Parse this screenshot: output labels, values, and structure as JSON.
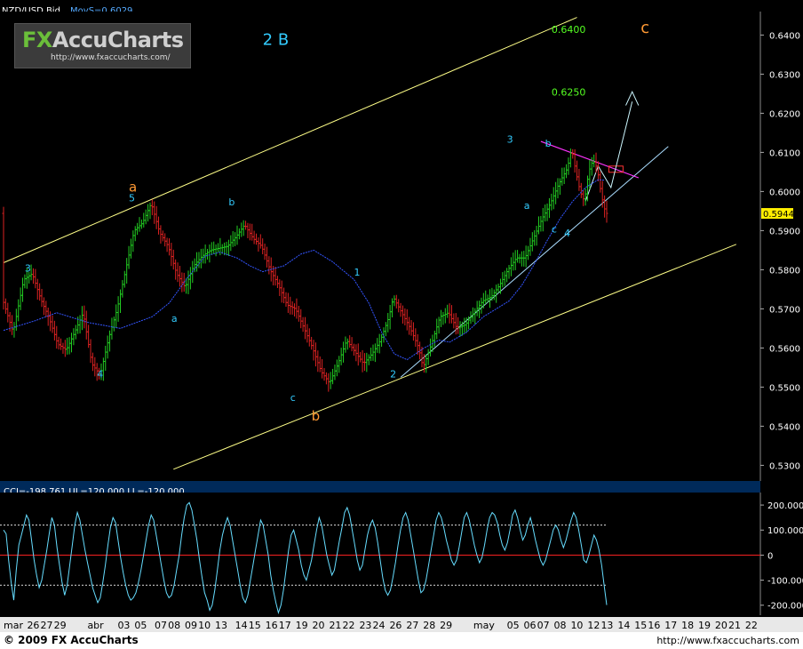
{
  "header": {
    "symbol": "NZD/USD Bid",
    "indicator": "MovS=0.6029"
  },
  "cci_header": {
    "text": "CCI=-198.761 UL=120.000 LL=-120.000"
  },
  "logo": {
    "brand_fx": "FX",
    "brand_rest": "AccuCharts",
    "url": "http://www.fxaccucharts.com/"
  },
  "footer": {
    "copyright": "© 2009 FX AccuCharts",
    "url": "http://www.fxaccucharts.com"
  },
  "colors": {
    "background": "#000000",
    "up_bar": "#22cc22",
    "down_bar": "#dd2222",
    "moving_average": "#3355ff",
    "channel": "#ffff88",
    "trendline": "#aaddff",
    "resistance": "#ff33ff",
    "cci": "#66ddff",
    "cci_zero": "#ff2222",
    "label_cyan": "#33ccff",
    "label_orange": "#ff9933",
    "label_green": "#55ff22"
  },
  "chart_data": [
    {
      "type": "line",
      "subtype": "ohlc-bars",
      "title": "NZD/USD Bid",
      "ylim": [
        0.526,
        0.646
      ],
      "y_ticks": [
        "0.6400",
        "0.6300",
        "0.6200",
        "0.6100",
        "0.6000",
        "0.5900",
        "0.5800",
        "0.5700",
        "0.5600",
        "0.5500",
        "0.5400",
        "0.5300"
      ],
      "current_price": "0.5944",
      "series": [
        {
          "name": "MovS",
          "points": [
            [
              0,
              0.5645
            ],
            [
              15,
              0.567
            ],
            [
              25,
              0.569
            ],
            [
              40,
              0.5665
            ],
            [
              55,
              0.565
            ],
            [
              70,
              0.568
            ],
            [
              78,
              0.5715
            ],
            [
              86,
              0.5775
            ],
            [
              95,
              0.5835
            ],
            [
              102,
              0.5845
            ],
            [
              110,
              0.583
            ],
            [
              116,
              0.581
            ],
            [
              122,
              0.5795
            ],
            [
              132,
              0.581
            ],
            [
              140,
              0.584
            ],
            [
              146,
              0.585
            ],
            [
              155,
              0.582
            ],
            [
              165,
              0.5775
            ],
            [
              172,
              0.5715
            ],
            [
              178,
              0.564
            ],
            [
              184,
              0.5585
            ],
            [
              190,
              0.557
            ],
            [
              198,
              0.56
            ],
            [
              205,
              0.562
            ],
            [
              210,
              0.5615
            ],
            [
              218,
              0.564
            ],
            [
              226,
              0.568
            ],
            [
              232,
              0.57
            ],
            [
              238,
              0.572
            ],
            [
              244,
              0.576
            ],
            [
              250,
              0.5815
            ],
            [
              256,
              0.5875
            ],
            [
              262,
              0.593
            ],
            [
              268,
              0.5975
            ],
            [
              274,
              0.601
            ],
            [
              280,
              0.603
            ],
            [
              283,
              0.6029
            ]
          ]
        },
        {
          "name": "Price",
          "points": [
            [
              0,
              0.5725
            ],
            [
              5,
              0.564
            ],
            [
              10,
              0.5775
            ],
            [
              14,
              0.579
            ],
            [
              18,
              0.5725
            ],
            [
              22,
              0.5675
            ],
            [
              26,
              0.561
            ],
            [
              30,
              0.5595
            ],
            [
              34,
              0.564
            ],
            [
              38,
              0.569
            ],
            [
              42,
              0.556
            ],
            [
              46,
              0.553
            ],
            [
              50,
              0.5625
            ],
            [
              54,
              0.57
            ],
            [
              58,
              0.58
            ],
            [
              62,
              0.59
            ],
            [
              66,
              0.592
            ],
            [
              70,
              0.597
            ],
            [
              74,
              0.5895
            ],
            [
              78,
              0.586
            ],
            [
              82,
              0.579
            ],
            [
              86,
              0.5755
            ],
            [
              90,
              0.581
            ],
            [
              94,
              0.5835
            ],
            [
              98,
              0.585
            ],
            [
              102,
              0.5855
            ],
            [
              106,
              0.586
            ],
            [
              110,
              0.5885
            ],
            [
              114,
              0.5915
            ],
            [
              118,
              0.588
            ],
            [
              122,
              0.586
            ],
            [
              126,
              0.58
            ],
            [
              130,
              0.576
            ],
            [
              134,
              0.571
            ],
            [
              138,
              0.57
            ],
            [
              142,
              0.565
            ],
            [
              146,
              0.56
            ],
            [
              150,
              0.554
            ],
            [
              154,
              0.551
            ],
            [
              158,
              0.556
            ],
            [
              162,
              0.562
            ],
            [
              166,
              0.559
            ],
            [
              170,
              0.556
            ],
            [
              174,
              0.5585
            ],
            [
              178,
              0.562
            ],
            [
              182,
              0.568
            ],
            [
              184,
              0.573
            ],
            [
              188,
              0.569
            ],
            [
              192,
              0.565
            ],
            [
              196,
              0.56
            ],
            [
              198,
              0.555
            ],
            [
              202,
              0.561
            ],
            [
              206,
              0.568
            ],
            [
              210,
              0.569
            ],
            [
              214,
              0.565
            ],
            [
              218,
              0.566
            ],
            [
              222,
              0.569
            ],
            [
              226,
              0.572
            ],
            [
              230,
              0.573
            ],
            [
              234,
              0.576
            ],
            [
              238,
              0.58
            ],
            [
              242,
              0.583
            ],
            [
              246,
              0.583
            ],
            [
              250,
              0.588
            ],
            [
              254,
              0.593
            ],
            [
              258,
              0.597
            ],
            [
              262,
              0.602
            ],
            [
              266,
              0.606
            ],
            [
              268,
              0.611
            ],
            [
              270,
              0.605
            ],
            [
              272,
              0.6
            ],
            [
              274,
              0.5975
            ],
            [
              276,
              0.605
            ],
            [
              278,
              0.608
            ],
            [
              280,
              0.606
            ],
            [
              282,
              0.599
            ],
            [
              284,
              0.5944
            ]
          ]
        }
      ],
      "annotations": [
        {
          "text": "2 B",
          "x": 122,
          "y": 0.6375,
          "color": "cyan",
          "size": "big"
        },
        {
          "text": "0.6400",
          "x": 258,
          "y": 0.6405,
          "color": "green"
        },
        {
          "text": "c",
          "x": 300,
          "y": 0.6405,
          "color": "orange",
          "size": "big"
        },
        {
          "text": "0.6250",
          "x": 258,
          "y": 0.6245,
          "color": "green"
        },
        {
          "text": "a",
          "x": 59,
          "y": 0.6,
          "color": "orange",
          "size": "mid"
        },
        {
          "text": "5",
          "x": 59,
          "y": 0.5975,
          "color": "cyan"
        },
        {
          "text": "3",
          "x": 10,
          "y": 0.5795,
          "color": "cyan"
        },
        {
          "text": "4",
          "x": 44,
          "y": 0.5525,
          "color": "cyan"
        },
        {
          "text": "a",
          "x": 79,
          "y": 0.5667,
          "color": "cyan"
        },
        {
          "text": "b",
          "x": 106,
          "y": 0.5965,
          "color": "cyan"
        },
        {
          "text": "c",
          "x": 135,
          "y": 0.5465,
          "color": "cyan"
        },
        {
          "text": "b",
          "x": 145,
          "y": 0.5415,
          "color": "orange",
          "size": "mid"
        },
        {
          "text": "1",
          "x": 165,
          "y": 0.5785,
          "color": "cyan"
        },
        {
          "text": "2",
          "x": 182,
          "y": 0.5525,
          "color": "cyan"
        },
        {
          "text": "3",
          "x": 237,
          "y": 0.6125,
          "color": "cyan"
        },
        {
          "text": "b",
          "x": 255,
          "y": 0.6115,
          "color": "cyan"
        },
        {
          "text": "a",
          "x": 245,
          "y": 0.5955,
          "color": "cyan"
        },
        {
          "text": "c",
          "x": 258,
          "y": 0.5895,
          "color": "cyan"
        },
        {
          "text": "4",
          "x": 264,
          "y": 0.5885,
          "color": "cyan"
        }
      ]
    },
    {
      "type": "line",
      "title": "CCI",
      "ylim": [
        -240,
        250
      ],
      "y_ticks": [
        "200.000",
        "100.000",
        "0",
        "-100.000",
        "-200.000"
      ],
      "upper_level": 120,
      "lower_level": -120,
      "series": [
        {
          "name": "CCI",
          "values": [
            100,
            85,
            -20,
            -110,
            -180,
            -60,
            40,
            80,
            120,
            160,
            140,
            60,
            -20,
            -80,
            -130,
            -100,
            -40,
            20,
            90,
            150,
            120,
            30,
            -40,
            -110,
            -160,
            -120,
            -40,
            40,
            120,
            170,
            140,
            80,
            20,
            -30,
            -80,
            -130,
            -160,
            -190,
            -170,
            -110,
            -40,
            40,
            110,
            150,
            130,
            60,
            -10,
            -70,
            -120,
            -160,
            -180,
            -170,
            -150,
            -110,
            -60,
            0,
            60,
            120,
            160,
            140,
            80,
            20,
            -40,
            -100,
            -150,
            -170,
            -160,
            -120,
            -60,
            0,
            80,
            150,
            200,
            210,
            180,
            120,
            60,
            -20,
            -90,
            -150,
            -180,
            -220,
            -200,
            -140,
            -60,
            20,
            80,
            120,
            150,
            120,
            60,
            0,
            -60,
            -120,
            -170,
            -190,
            -160,
            -100,
            -40,
            20,
            80,
            140,
            120,
            60,
            0,
            -80,
            -140,
            -190,
            -230,
            -200,
            -140,
            -60,
            20,
            80,
            100,
            60,
            20,
            -40,
            -80,
            -100,
            -60,
            -20,
            40,
            100,
            150,
            120,
            60,
            0,
            -40,
            -80,
            -60,
            0,
            60,
            110,
            170,
            190,
            160,
            100,
            40,
            -20,
            -60,
            -40,
            20,
            80,
            120,
            140,
            110,
            50,
            -20,
            -90,
            -140,
            -160,
            -140,
            -90,
            -30,
            40,
            100,
            150,
            170,
            140,
            80,
            20,
            -40,
            -100,
            -150,
            -140,
            -100,
            -40,
            20,
            80,
            140,
            170,
            150,
            110,
            60,
            20,
            -20,
            -40,
            -20,
            30,
            90,
            150,
            170,
            140,
            90,
            40,
            0,
            -30,
            -10,
            40,
            100,
            150,
            170,
            160,
            130,
            80,
            40,
            20,
            50,
            100,
            160,
            180,
            150,
            100,
            60,
            80,
            120,
            150,
            110,
            60,
            20,
            -20,
            -40,
            -20,
            20,
            60,
            100,
            120,
            100,
            60,
            30,
            60,
            100,
            140,
            170,
            150,
            100,
            40,
            -20,
            -30,
            0,
            40,
            80,
            60,
            20,
            -40,
            -120,
            -199
          ]
        }
      ]
    }
  ],
  "x_axis": {
    "labels": [
      {
        "text": "mar",
        "i": 0
      },
      {
        "text": "26",
        "i": 7
      },
      {
        "text": "27",
        "i": 11
      },
      {
        "text": "29",
        "i": 15
      },
      {
        "text": "abr",
        "i": 25
      },
      {
        "text": "03",
        "i": 34
      },
      {
        "text": "05",
        "i": 39
      },
      {
        "text": "07",
        "i": 45
      },
      {
        "text": "08",
        "i": 49
      },
      {
        "text": "09",
        "i": 54
      },
      {
        "text": "10",
        "i": 58
      },
      {
        "text": "13",
        "i": 63
      },
      {
        "text": "14",
        "i": 69
      },
      {
        "text": "15",
        "i": 73
      },
      {
        "text": "16",
        "i": 78
      },
      {
        "text": "17",
        "i": 82
      },
      {
        "text": "19",
        "i": 87
      },
      {
        "text": "20",
        "i": 92
      },
      {
        "text": "21",
        "i": 97
      },
      {
        "text": "22",
        "i": 101
      },
      {
        "text": "23",
        "i": 106
      },
      {
        "text": "24",
        "i": 110
      },
      {
        "text": "26",
        "i": 115
      },
      {
        "text": "27",
        "i": 120
      },
      {
        "text": "28",
        "i": 125
      },
      {
        "text": "29",
        "i": 130
      },
      {
        "text": "may",
        "i": 140
      },
      {
        "text": "05",
        "i": 150
      },
      {
        "text": "06",
        "i": 155
      },
      {
        "text": "07",
        "i": 159
      },
      {
        "text": "08",
        "i": 164
      },
      {
        "text": "10",
        "i": 169
      },
      {
        "text": "12",
        "i": 174
      },
      {
        "text": "13",
        "i": 178
      },
      {
        "text": "14",
        "i": 183
      },
      {
        "text": "15",
        "i": 188
      },
      {
        "text": "16",
        "i": 192
      },
      {
        "text": "17",
        "i": 197
      },
      {
        "text": "18",
        "i": 202
      },
      {
        "text": "19",
        "i": 207
      },
      {
        "text": "20",
        "i": 212
      },
      {
        "text": "21",
        "i": 216
      },
      {
        "text": "22",
        "i": 221
      }
    ],
    "count": 226
  }
}
